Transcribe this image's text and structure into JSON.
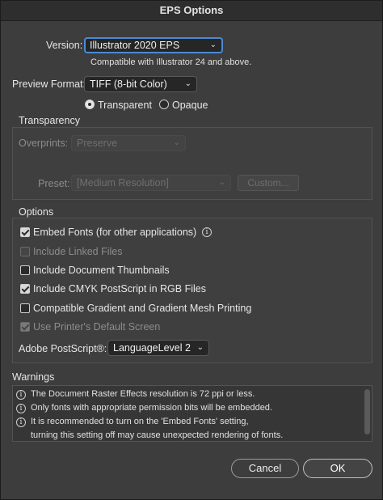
{
  "window": {
    "title": "EPS Options"
  },
  "version": {
    "label": "Version:",
    "value": "Illustrator 2020 EPS",
    "note": "Compatible with Illustrator 24 and above."
  },
  "preview": {
    "label": "Preview Format:",
    "value": "TIFF (8-bit Color)",
    "transparent_label": "Transparent",
    "opaque_label": "Opaque",
    "selected": "Transparent"
  },
  "transparency": {
    "title": "Transparency",
    "overprints_label": "Overprints:",
    "overprints_value": "Preserve",
    "preset_label": "Preset:",
    "preset_value": "[Medium Resolution]",
    "custom_label": "Custom..."
  },
  "options": {
    "title": "Options",
    "items": [
      {
        "label": "Embed Fonts (for other applications)",
        "checked": true,
        "enabled": true
      },
      {
        "label": "Include Linked Files",
        "checked": false,
        "enabled": false
      },
      {
        "label": "Include Document Thumbnails",
        "checked": false,
        "enabled": true
      },
      {
        "label": "Include CMYK PostScript in RGB Files",
        "checked": true,
        "enabled": true
      },
      {
        "label": "Compatible Gradient and Gradient Mesh Printing",
        "checked": false,
        "enabled": true
      },
      {
        "label": "Use Printer's Default Screen",
        "checked": true,
        "enabled": false
      }
    ],
    "postscript_label": "Adobe PostScript®:",
    "postscript_value": "LanguageLevel 2"
  },
  "warnings": {
    "title": "Warnings",
    "items": [
      "The Document Raster Effects resolution is 72 ppi or less.",
      "Only fonts with appropriate permission bits will be embedded.",
      "It is recommended to turn on the 'Embed Fonts' setting,",
      "turning this setting off may cause unexpected rendering of fonts."
    ]
  },
  "buttons": {
    "cancel": "Cancel",
    "ok": "OK"
  },
  "icons": {
    "info": "info-icon",
    "chevron": "chevron-down-icon",
    "check": "checkmark-icon"
  }
}
